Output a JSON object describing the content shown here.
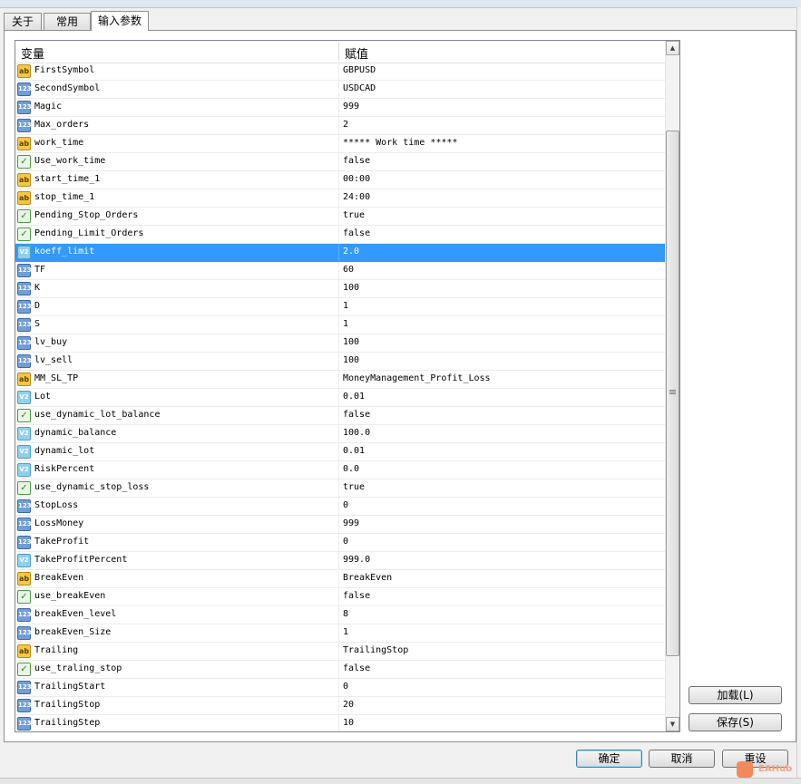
{
  "tabs": [
    {
      "label": "关于"
    },
    {
      "label": "常用"
    },
    {
      "label": "输入参数"
    }
  ],
  "grid": {
    "col_variable": "变量",
    "col_value": "赋值",
    "rows": [
      {
        "type": "ab",
        "name": "FirstSymbol",
        "value": "GBPUSD"
      },
      {
        "type": "123",
        "name": "SecondSymbol",
        "value": "USDCAD"
      },
      {
        "type": "123",
        "name": "Magic",
        "value": "999"
      },
      {
        "type": "123",
        "name": "Max_orders",
        "value": "2"
      },
      {
        "type": "ab",
        "name": "work_time",
        "value": "***** Work time *****"
      },
      {
        "type": "bool",
        "name": "Use_work_time",
        "value": "false"
      },
      {
        "type": "ab",
        "name": "start_time_1",
        "value": "00:00"
      },
      {
        "type": "ab",
        "name": "stop_time_1",
        "value": "24:00"
      },
      {
        "type": "bool",
        "name": "Pending_Stop_Orders",
        "value": "true"
      },
      {
        "type": "bool",
        "name": "Pending_Limit_Orders",
        "value": "false"
      },
      {
        "type": "v2",
        "name": "koeff_limit",
        "value": "2.0"
      },
      {
        "type": "123",
        "name": "TF",
        "value": "60"
      },
      {
        "type": "123",
        "name": "K",
        "value": "100"
      },
      {
        "type": "123",
        "name": "D",
        "value": "1"
      },
      {
        "type": "123",
        "name": "S",
        "value": "1"
      },
      {
        "type": "123",
        "name": "lv_buy",
        "value": "100"
      },
      {
        "type": "123",
        "name": "lv_sell",
        "value": "100"
      },
      {
        "type": "ab",
        "name": "MM_SL_TP",
        "value": "MoneyManagement_Profit_Loss"
      },
      {
        "type": "v2",
        "name": "Lot",
        "value": "0.01"
      },
      {
        "type": "bool",
        "name": "use_dynamic_lot_balance",
        "value": "false"
      },
      {
        "type": "v2",
        "name": "dynamic_balance",
        "value": "100.0"
      },
      {
        "type": "v2",
        "name": "dynamic_lot",
        "value": "0.01"
      },
      {
        "type": "v2",
        "name": "RiskPercent",
        "value": "0.0"
      },
      {
        "type": "bool",
        "name": "use_dynamic_stop_loss",
        "value": "true"
      },
      {
        "type": "123",
        "name": "StopLoss",
        "value": "0"
      },
      {
        "type": "123",
        "name": "LossMoney",
        "value": "999"
      },
      {
        "type": "123",
        "name": "TakeProfit",
        "value": "0"
      },
      {
        "type": "v2",
        "name": "TakeProfitPercent",
        "value": "999.0"
      },
      {
        "type": "ab",
        "name": "BreakEven",
        "value": "BreakEven"
      },
      {
        "type": "bool",
        "name": "use_breakEven",
        "value": "false"
      },
      {
        "type": "123",
        "name": "breakEven_level",
        "value": "8"
      },
      {
        "type": "123",
        "name": "breakEven_Size",
        "value": "1"
      },
      {
        "type": "ab",
        "name": "Trailing",
        "value": "TrailingStop"
      },
      {
        "type": "bool",
        "name": "use_traling_stop",
        "value": "false"
      },
      {
        "type": "123",
        "name": "TrailingStart",
        "value": "0"
      },
      {
        "type": "123",
        "name": "TrailingStop",
        "value": "20"
      },
      {
        "type": "123",
        "name": "TrailingStep",
        "value": "10"
      }
    ]
  },
  "icon_labels": {
    "ab": "ab",
    "123": "123",
    "bool": "✓",
    "v2": "V2"
  },
  "buttons": {
    "load": "加载(L)",
    "save": "保存(S)",
    "ok": "确定",
    "cancel": "取消",
    "reset": "重设"
  },
  "watermark": "EAHub",
  "colors": {
    "selection": "#3399ff"
  }
}
